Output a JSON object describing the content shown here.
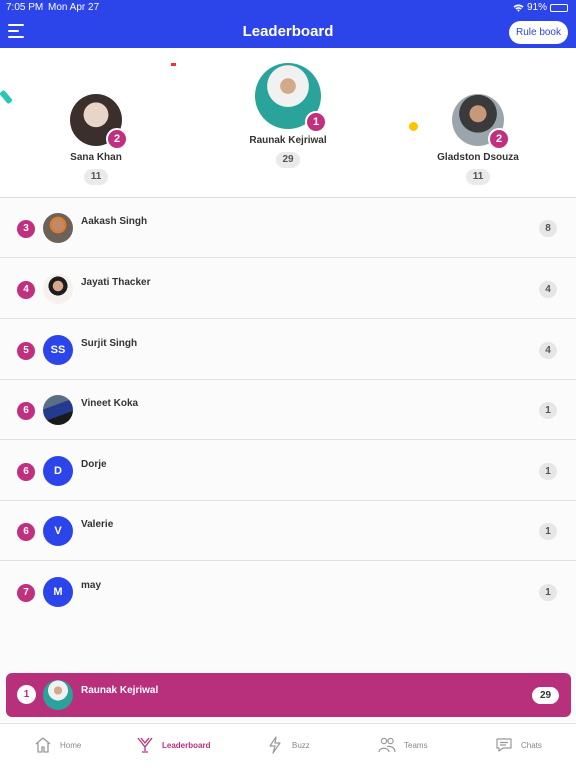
{
  "status_bar": {
    "time": "7:05 PM",
    "date": "Mon Apr 27",
    "battery": "91%",
    "battery_level": 0.91
  },
  "header": {
    "title": "Leaderboard",
    "rule_book_label": "Rule book"
  },
  "podium": [
    {
      "rank": "2",
      "name": "Sana  Khan",
      "points": "11"
    },
    {
      "rank": "1",
      "name": "Raunak Kejriwal",
      "points": "29"
    },
    {
      "rank": "2",
      "name": "Gladston  Dsouza",
      "points": "11"
    }
  ],
  "list": [
    {
      "rank": "3",
      "name": "Aakash Singh",
      "points": "8",
      "initials": ""
    },
    {
      "rank": "4",
      "name": "Jayati  Thacker",
      "points": "4",
      "initials": ""
    },
    {
      "rank": "5",
      "name": "Surjit Singh",
      "points": "4",
      "initials": "SS"
    },
    {
      "rank": "6",
      "name": "Vineet  Koka",
      "points": "1",
      "initials": ""
    },
    {
      "rank": "6",
      "name": "Dorje",
      "points": "1",
      "initials": "D"
    },
    {
      "rank": "6",
      "name": "Valerie",
      "points": "1",
      "initials": "V"
    },
    {
      "rank": "7",
      "name": "may",
      "points": "1",
      "initials": "M"
    }
  ],
  "current_user": {
    "rank": "1",
    "name": "Raunak Kejriwal",
    "points": "29"
  },
  "tabs": [
    {
      "label": "Home",
      "icon": "home-icon"
    },
    {
      "label": "Leaderboard",
      "icon": "leaderboard-icon"
    },
    {
      "label": "Buzz",
      "icon": "bolt-icon"
    },
    {
      "label": "Teams",
      "icon": "teams-icon"
    },
    {
      "label": "Chats",
      "icon": "chat-icon"
    }
  ],
  "colors": {
    "header": "#2b45ea",
    "accent": "#b8307c",
    "avatar_blue": "#2b45ea"
  }
}
